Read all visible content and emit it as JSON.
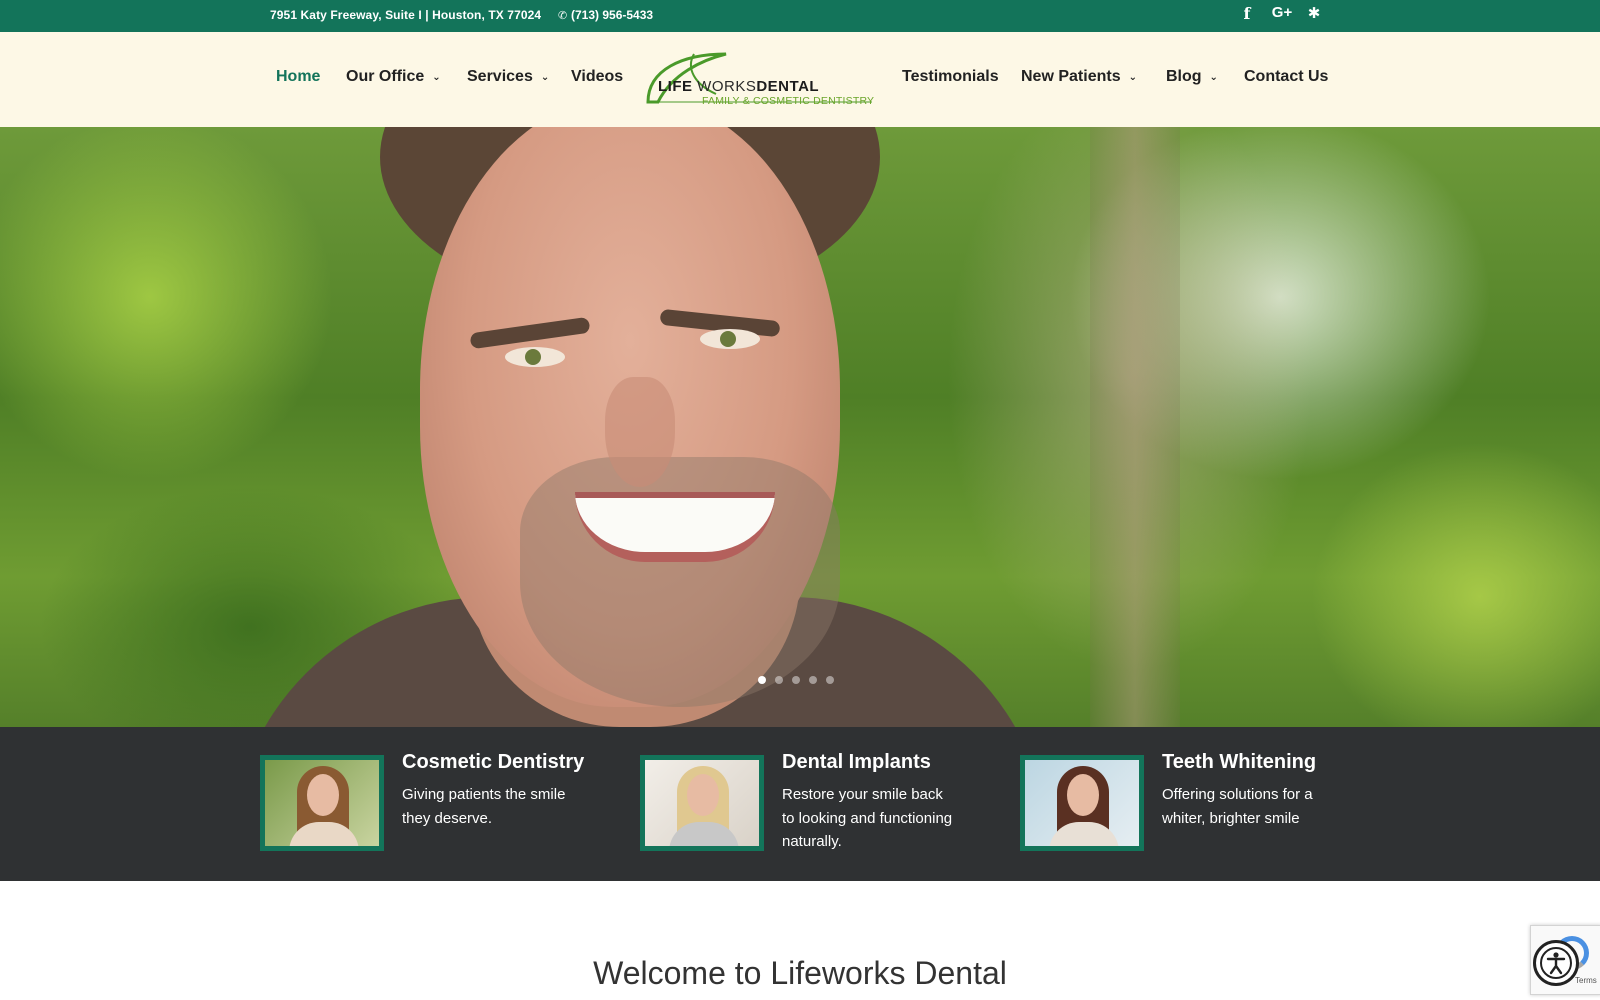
{
  "topbar": {
    "address": "7951 Katy Freeway, Suite I | Houston, TX 77024",
    "phone": "(713) 956-5433",
    "social": [
      {
        "name": "facebook-icon",
        "glyph": "f"
      },
      {
        "name": "google-plus-icon",
        "glyph": "G+"
      },
      {
        "name": "yelp-icon",
        "glyph": "✱"
      }
    ]
  },
  "nav": {
    "left": [
      {
        "label": "Home",
        "active": true,
        "dropdown": false
      },
      {
        "label": "Our Office",
        "active": false,
        "dropdown": true
      },
      {
        "label": "Services",
        "active": false,
        "dropdown": true
      },
      {
        "label": "Videos",
        "active": false,
        "dropdown": false
      }
    ],
    "right": [
      {
        "label": "Testimonials",
        "dropdown": false
      },
      {
        "label": "New Patients",
        "dropdown": true
      },
      {
        "label": "Blog",
        "dropdown": true
      },
      {
        "label": "Contact Us",
        "dropdown": false
      }
    ],
    "dropdown_glyph": "⌄"
  },
  "logo": {
    "life": "LIFE",
    "works": "WORKS",
    "dental": "DENTAL",
    "tagline": "FAMILY & COSMETIC DENTISTRY"
  },
  "hero": {
    "slide_count": 5,
    "active_slide": 1
  },
  "services": [
    {
      "title": "Cosmetic Dentistry",
      "lines": [
        "Giving patients the smile",
        "they deserve."
      ]
    },
    {
      "title": "Dental Implants",
      "lines": [
        "Restore your smile back",
        "to looking and functioning",
        "naturally."
      ]
    },
    {
      "title": "Teeth Whitening",
      "lines": [
        "Offering solutions for a",
        "whiter, brighter smile"
      ]
    }
  ],
  "welcome": {
    "heading": "Welcome to Lifeworks Dental"
  },
  "recaptcha": {
    "terms": "Terms"
  },
  "colors": {
    "brand_green": "#13745a",
    "nav_bg": "#fdf8e6",
    "strip_bg": "#2f3133",
    "logo_tagline": "#6aa52a"
  }
}
